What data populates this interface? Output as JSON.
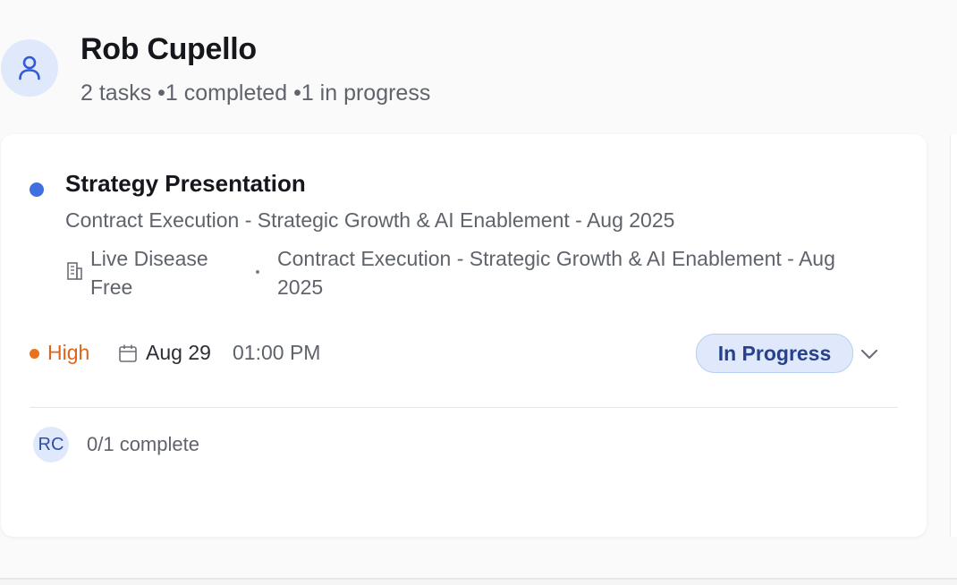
{
  "person": {
    "name": "Rob Cupello",
    "task_count": "2 tasks",
    "completed": "•1 completed",
    "in_progress": "•1 in progress"
  },
  "task": {
    "title": "Strategy Presentation",
    "subtitle": "Contract Execution - Strategic Growth & AI Enablement - Aug 2025",
    "organization": "Live Disease Free",
    "project": "Contract Execution - Strategic Growth & AI Enablement - Aug 2025",
    "priority": "High",
    "due_date": "Aug 29",
    "due_time": "01:00 PM",
    "status": "In Progress",
    "assignee_initials": "RC",
    "progress": "0/1 complete"
  },
  "colors": {
    "accent_blue": "#3f6fe0",
    "priority_high": "#e0641a",
    "status_bg": "#dfe9fb",
    "status_text": "#27418f"
  },
  "icons": {
    "avatar": "user-icon",
    "organization": "building-icon",
    "date": "calendar-icon",
    "dropdown": "chevron-down-icon"
  }
}
